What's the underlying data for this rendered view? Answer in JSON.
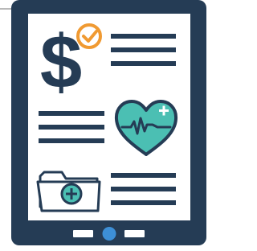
{
  "illustration": {
    "icons": [
      "tablet-icon",
      "dollar-icon",
      "checkmark-badge-icon",
      "heart-icon",
      "heartbeat-line-icon",
      "medical-plus-icon",
      "folder-icon",
      "folder-plus-icon",
      "home-button-icon"
    ],
    "text_line_groups": 3,
    "lines_per_group": 3
  },
  "colors": {
    "frame": "#253c55",
    "screen": "#ffffff",
    "accent_orange": "#f09a32",
    "heart_teal": "#4bbfb3",
    "home_button": "#3d8fd6",
    "folder_fill": "#ffffff",
    "connector_line": "#b9b9b9"
  }
}
